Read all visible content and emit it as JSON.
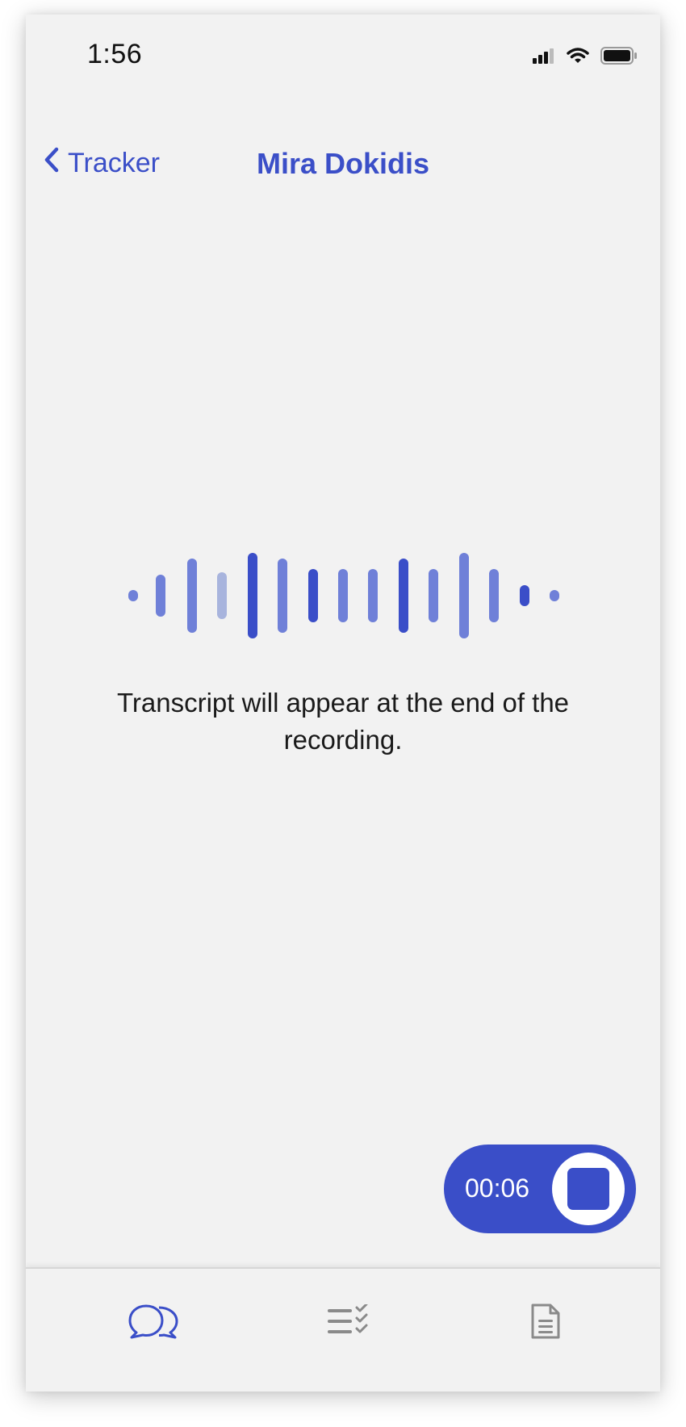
{
  "status_bar": {
    "time": "1:56",
    "icons": [
      "signal-icon",
      "wifi-icon",
      "battery-icon"
    ]
  },
  "nav": {
    "back_label": "Tracker",
    "back_icon": "chevron-left-icon",
    "title": "Mira Dokidis"
  },
  "main": {
    "transcript_note": "Transcript will appear at the end of the recording."
  },
  "recorder": {
    "elapsed": "00:06",
    "stop_icon": "stop-icon"
  },
  "tab_bar": {
    "tabs": [
      {
        "icon": "conversation-icon",
        "active": true
      },
      {
        "icon": "checklist-icon",
        "active": false
      },
      {
        "icon": "document-icon",
        "active": false
      }
    ]
  },
  "colors": {
    "accent": "#3a4ec8",
    "background": "#f2f2f2",
    "inactive_icon": "#8a8a8a"
  }
}
